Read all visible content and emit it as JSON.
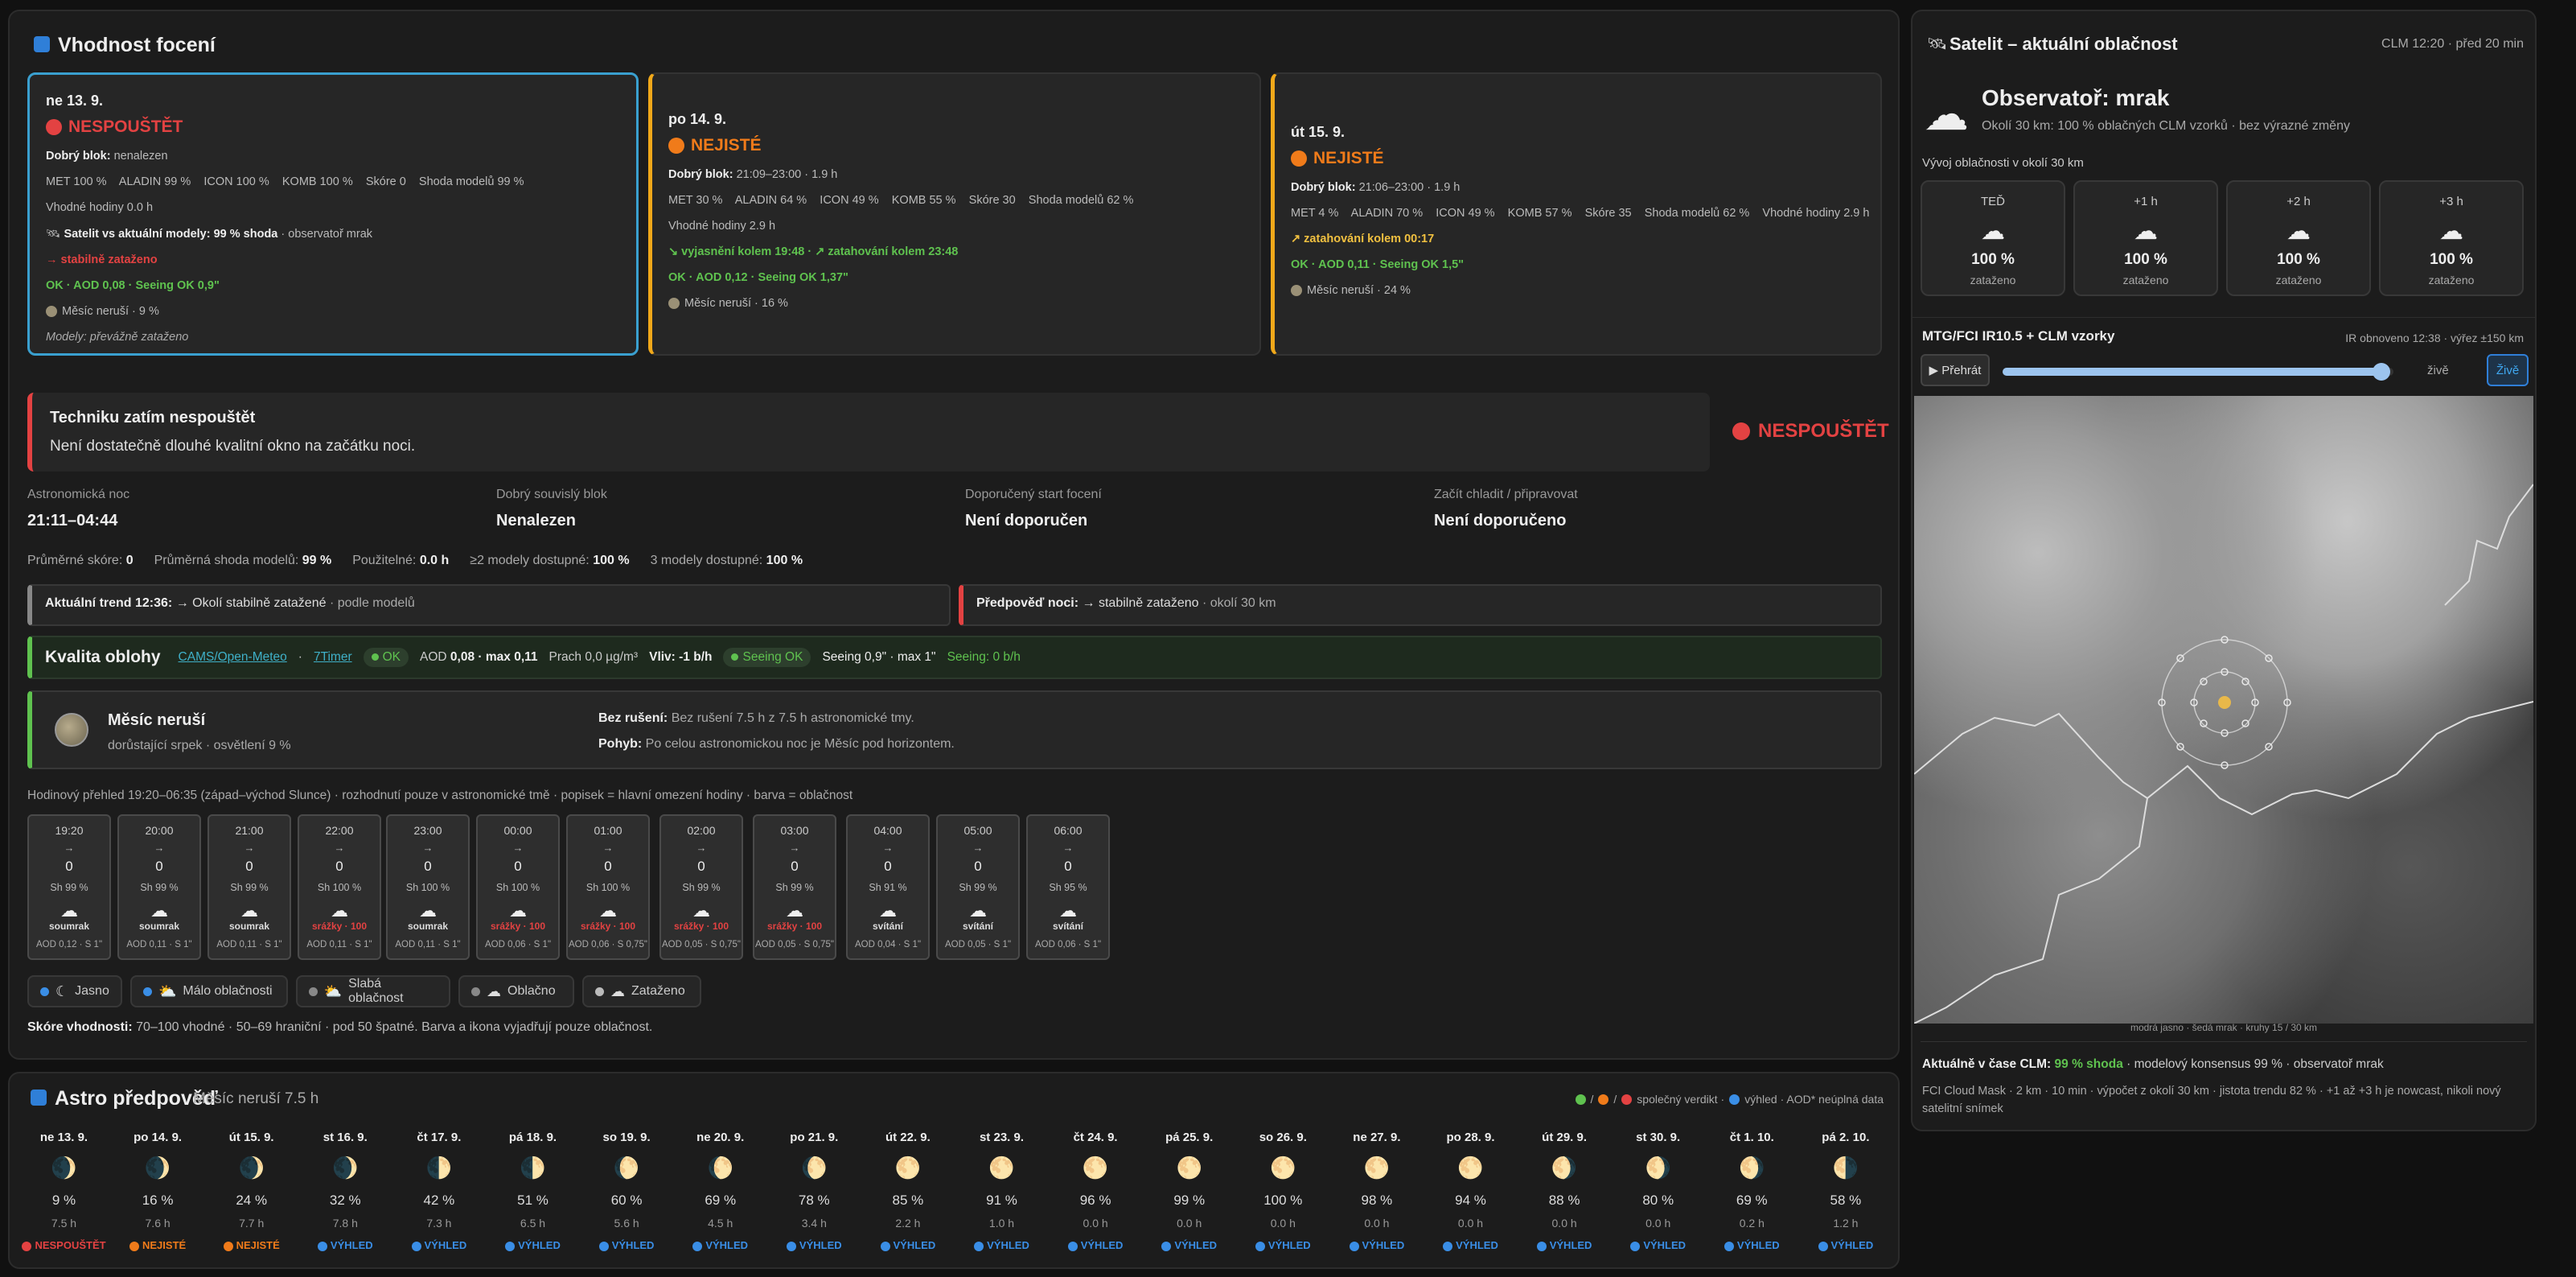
{
  "suitability": {
    "title": "Vhodnost focení",
    "cards": [
      {
        "date": "ne 13. 9.",
        "verdict": "NESPOUŠTĚT",
        "block_label": "Dobrý blok:",
        "block": "nenalezen",
        "models": "MET 100 %    ALADIN 99 %    ICON 100 %    KOMB 100 %    Skóre 0    Shoda modelů 99 %",
        "hours": "Vhodné hodiny 0.0 h",
        "sat_label": "Satelit vs aktuální modely:",
        "sat_value": "99 % shoda",
        "sat_rest": "· observatoř mrak",
        "trend": "→ stabilně zataženo",
        "aod": "OK · AOD 0,08 · Seeing OK 0,9\"",
        "moon": "Měsíc neruší · 9 %",
        "modely": "Modely: převážně zataženo"
      },
      {
        "date": "po 14. 9.",
        "verdict": "NEJISTÉ",
        "block_label": "Dobrý blok:",
        "block": "21:09–23:00 · 1.9 h",
        "models": "MET 30 %    ALADIN 64 %    ICON 49 %    KOMB 55 %    Skóre 30    Shoda modelů 62 %",
        "hours": "Vhodné hodiny 2.9 h",
        "trend": "↘ vyjasnění kolem 19:48 · ↗ zatahování kolem 23:48",
        "aod": "OK · AOD 0,12 · Seeing OK 1,37\"",
        "moon": "Měsíc neruší · 16 %"
      },
      {
        "date": "út 15. 9.",
        "verdict": "NEJISTÉ",
        "block_label": "Dobrý blok:",
        "block": "21:06–23:00 · 1.9 h",
        "models": "MET 4 %    ALADIN 70 %    ICON 49 %    KOMB 57 %    Skóre 35    Shoda modelů 62 %    Vhodné hodiny 2.9 h",
        "trend": "↗ zatahování kolem 00:17",
        "aod": "OK · AOD 0,11 · Seeing OK 1,5\"",
        "moon": "Měsíc neruší · 24 %"
      }
    ],
    "alert": {
      "title": "Techniku zatím nespouštět",
      "text": "Není dostatečně dlouhé kvalitní okno na začátku noci.",
      "verdict": "NESPOUŠTĚT"
    },
    "stats": [
      {
        "label": "Astronomická noc",
        "value": "21:11–04:44"
      },
      {
        "label": "Dobrý souvislý blok",
        "value": "Nenalezen"
      },
      {
        "label": "Doporučený start focení",
        "value": "Není doporučen"
      },
      {
        "label": "Začít chladit / připravovat",
        "value": "Není doporučeno"
      }
    ],
    "summary": [
      {
        "label": "Průměrné skóre:",
        "value": "0"
      },
      {
        "label": "Průměrná shoda modelů:",
        "value": "99 %"
      },
      {
        "label": "Použitelné:",
        "value": "0.0 h"
      },
      {
        "label": "≥2 modely dostupné:",
        "value": "100 %"
      },
      {
        "label": "3 modely dostupné:",
        "value": "100 %"
      }
    ],
    "trend_now": {
      "label": "Aktuální trend 12:36:",
      "text": "→ Okolí stabilně zatažené",
      "rest": "· podle modelů"
    },
    "trend_night": {
      "label": "Předpověď noci:",
      "text": "→ stabilně zataženo",
      "rest": "· okolí 30 km"
    },
    "sky": {
      "title": "Kvalita oblohy",
      "link1": "CAMS/Open-Meteo",
      "sep": "·",
      "link2": "7Timer",
      "ok": "OK",
      "aod_label": "AOD",
      "aod": "0,08 · max 0,11",
      "dust": "Prach 0,0 µg/m³",
      "vliv": "Vliv: -1 b/h",
      "seeing_ok": "Seeing OK",
      "seeing": "Seeing 0,9\" · max 1\"",
      "seeing_gain": "Seeing: 0 b/h"
    },
    "moon": {
      "title": "Měsíc neruší",
      "sub": "dorůstající srpek · osvětlení 9 %",
      "l1": "Bez rušení:",
      "v1": "Bez rušení 7.5 h z 7.5 h astronomické tmy.",
      "l2": "Pohyb:",
      "v2": "Po celou astronomickou noc je Měsíc pod horizontem."
    },
    "hourly_caption": "Hodinový přehled 19:20–06:35 (západ–východ Slunce) · rozhodnutí pouze v astronomické tmě · popisek = hlavní omezení hodiny · barva = oblačnost",
    "hours": [
      {
        "t": "19:20",
        "sh": "Sh 99 %",
        "st": "soumrak",
        "ao": "AOD 0,12 · S 1\"",
        "sc": "#ddd"
      },
      {
        "t": "20:00",
        "sh": "Sh 99 %",
        "st": "soumrak",
        "ao": "AOD 0,11 · S 1\"",
        "sc": "#ddd"
      },
      {
        "t": "21:00",
        "sh": "Sh 99 %",
        "st": "soumrak",
        "ao": "AOD 0,11 · S 1\"",
        "sc": "#ddd"
      },
      {
        "t": "22:00",
        "sh": "Sh 100 %",
        "st": "srážky · 100",
        "ao": "AOD 0,11 · S 1\"",
        "sc": "#e34242"
      },
      {
        "t": "23:00",
        "sh": "Sh 100 %",
        "st": "soumrak",
        "ao": "AOD 0,11 · S 1\"",
        "sc": "#ddd"
      },
      {
        "t": "00:00",
        "sh": "Sh 100 %",
        "st": "srážky · 100",
        "ao": "AOD 0,06 · S 1\"",
        "sc": "#e34242"
      },
      {
        "t": "01:00",
        "sh": "Sh 100 %",
        "st": "srážky · 100",
        "ao": "AOD 0,06 · S 0,75\"",
        "sc": "#e34242"
      },
      {
        "t": "02:00",
        "sh": "Sh 99 %",
        "st": "srážky · 100",
        "ao": "AOD 0,05 · S 0,75\"",
        "sc": "#e34242"
      },
      {
        "t": "03:00",
        "sh": "Sh 99 %",
        "st": "srážky · 100",
        "ao": "AOD 0,05 · S 0,75\"",
        "sc": "#e34242"
      },
      {
        "t": "04:00",
        "sh": "Sh 91 %",
        "st": "svítání",
        "ao": "AOD 0,04 · S 1\"",
        "sc": "#ddd"
      },
      {
        "t": "05:00",
        "sh": "Sh 99 %",
        "st": "svítání",
        "ao": "AOD 0,05 · S 1\"",
        "sc": "#ddd"
      },
      {
        "t": "06:00",
        "sh": "Sh 95 %",
        "st": "svítání",
        "ao": "AOD 0,06 · S 1\"",
        "sc": "#ddd"
      }
    ],
    "legend": [
      {
        "label": "Jasno",
        "icon": "☾",
        "color": "#3a8ee6"
      },
      {
        "label": "Málo oblačnosti",
        "icon": "⛅",
        "color": "#3a8ee6"
      },
      {
        "label": "Slabá oblačnost",
        "icon": "⛅",
        "color": "#888888"
      },
      {
        "label": "Oblačno",
        "icon": "☁",
        "color": "#888888"
      },
      {
        "label": "Zataženo",
        "icon": "☁",
        "color": "#bbbbbb"
      }
    ],
    "score_label": "Skóre vhodnosti:",
    "score_text": "70–100 vhodné · 50–69 hraniční · pod 50 špatné. Barva a ikona vyjadřují pouze oblačnost."
  },
  "astro": {
    "title": "Astro předpověď",
    "subtitle": "Měsíc neruší 7.5 h",
    "legend_a": "společný verdikt ·",
    "legend_b": "výhled · AOD* neúplná data",
    "days": [
      {
        "d": "ne 13. 9.",
        "p": "9 %",
        "h": "7.5 h",
        "v": "NESPOUŠTĚT",
        "c": "#e34242",
        "m": "🌒"
      },
      {
        "d": "po 14. 9.",
        "p": "16 %",
        "h": "7.6 h",
        "v": "NEJISTÉ",
        "c": "#f07b1a",
        "m": "🌒"
      },
      {
        "d": "út 15. 9.",
        "p": "24 %",
        "h": "7.7 h",
        "v": "NEJISTÉ",
        "c": "#f07b1a",
        "m": "🌒"
      },
      {
        "d": "st 16. 9.",
        "p": "32 %",
        "h": "7.8 h",
        "v": "VÝHLED",
        "c": "#3a8ee6",
        "m": "🌒"
      },
      {
        "d": "čt 17. 9.",
        "p": "42 %",
        "h": "7.3 h",
        "v": "VÝHLED",
        "c": "#3a8ee6",
        "m": "🌓"
      },
      {
        "d": "pá 18. 9.",
        "p": "51 %",
        "h": "6.5 h",
        "v": "VÝHLED",
        "c": "#3a8ee6",
        "m": "🌓"
      },
      {
        "d": "so 19. 9.",
        "p": "60 %",
        "h": "5.6 h",
        "v": "VÝHLED",
        "c": "#3a8ee6",
        "m": "🌔"
      },
      {
        "d": "ne 20. 9.",
        "p": "69 %",
        "h": "4.5 h",
        "v": "VÝHLED",
        "c": "#3a8ee6",
        "m": "🌔"
      },
      {
        "d": "po 21. 9.",
        "p": "78 %",
        "h": "3.4 h",
        "v": "VÝHLED",
        "c": "#3a8ee6",
        "m": "🌔"
      },
      {
        "d": "út 22. 9.",
        "p": "85 %",
        "h": "2.2 h",
        "v": "VÝHLED",
        "c": "#3a8ee6",
        "m": "🌕"
      },
      {
        "d": "st 23. 9.",
        "p": "91 %",
        "h": "1.0 h",
        "v": "VÝHLED",
        "c": "#3a8ee6",
        "m": "🌕"
      },
      {
        "d": "čt 24. 9.",
        "p": "96 %",
        "h": "0.0 h",
        "v": "VÝHLED",
        "c": "#3a8ee6",
        "m": "🌕"
      },
      {
        "d": "pá 25. 9.",
        "p": "99 %",
        "h": "0.0 h",
        "v": "VÝHLED",
        "c": "#3a8ee6",
        "m": "🌕"
      },
      {
        "d": "so 26. 9.",
        "p": "100 %",
        "h": "0.0 h",
        "v": "VÝHLED",
        "c": "#3a8ee6",
        "m": "🌕"
      },
      {
        "d": "ne 27. 9.",
        "p": "98 %",
        "h": "0.0 h",
        "v": "VÝHLED",
        "c": "#3a8ee6",
        "m": "🌕"
      },
      {
        "d": "po 28. 9.",
        "p": "94 %",
        "h": "0.0 h",
        "v": "VÝHLED",
        "c": "#3a8ee6",
        "m": "🌕"
      },
      {
        "d": "út 29. 9.",
        "p": "88 %",
        "h": "0.0 h",
        "v": "VÝHLED",
        "c": "#3a8ee6",
        "m": "🌖"
      },
      {
        "d": "st 30. 9.",
        "p": "80 %",
        "h": "0.0 h",
        "v": "VÝHLED",
        "c": "#3a8ee6",
        "m": "🌖"
      },
      {
        "d": "čt 1. 10.",
        "p": "69 %",
        "h": "0.2 h",
        "v": "VÝHLED",
        "c": "#3a8ee6",
        "m": "🌖"
      },
      {
        "d": "pá 2. 10.",
        "p": "58 %",
        "h": "1.2 h",
        "v": "VÝHLED",
        "c": "#3a8ee6",
        "m": "🌗"
      }
    ]
  },
  "satellite": {
    "title": "Satelit – aktuální oblačnost",
    "meta": "CLM 12:20 · před 20 min",
    "obs_title": "Observatoř: mrak",
    "obs_sub": "Okolí 30 km: 100 % oblačných CLM vzorků · bez výrazné změny",
    "evo_label": "Vývoj oblačnosti v okolí 30 km",
    "forecast": [
      {
        "a": "TEĎ",
        "b": "100 %",
        "c": "zataženo"
      },
      {
        "a": "+1 h",
        "b": "100 %",
        "c": "zataženo"
      },
      {
        "a": "+2 h",
        "b": "100 %",
        "c": "zataženo"
      },
      {
        "a": "+3 h",
        "b": "100 %",
        "c": "zataženo"
      }
    ],
    "ir_title": "MTG/FCI IR10.5 + CLM vzorky",
    "ir_meta": "IR obnoveno 12:38 · výřez ±150 km",
    "play": "▶ Přehrát",
    "live_label": "živě",
    "live_btn": "Živě",
    "slider": 0.97,
    "map_caption": "modrá jasno · šedá mrak · kruhy 15 / 30 km",
    "now_label": "Aktuálně v čase CLM:",
    "now_green": "99 % shoda",
    "now_rest": "· modelový konsensus 99 % · observatoř mrak",
    "footer": "FCI Cloud Mask · 2 km · 10 min · výpočet z okolí 30 km · jistota trendu 82 % · +1 až +3 h je nowcast, nikoli nový satelitní snímek"
  }
}
